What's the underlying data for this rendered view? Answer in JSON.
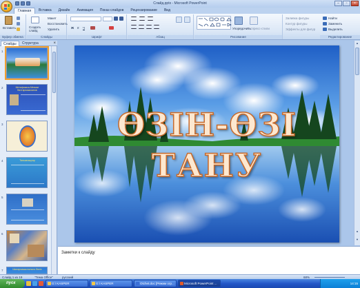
{
  "window": {
    "title": "Слайд.pptx - Microsoft PowerPoint"
  },
  "ribbon": {
    "tabs": [
      "Главная",
      "Вставка",
      "Дизайн",
      "Анимация",
      "Показ слайдов",
      "Рецензирование",
      "Вид"
    ],
    "active_tab": "Главная",
    "groups": {
      "clipboard": {
        "label": "Буфер обмена",
        "paste": "Вставить"
      },
      "slides": {
        "label": "Слайды",
        "create": "Создать слайд",
        "layout": "Макет",
        "reset": "Восстановить",
        "delete": "Удалить"
      },
      "font": {
        "label": "Шрифт"
      },
      "paragraph": {
        "label": "Абзац"
      },
      "drawing": {
        "label": "Рисование",
        "arrange": "Упорядочить",
        "quick_styles": "Экспресс-стили",
        "fill": "Заливка фигуры",
        "outline": "Контур фигуры",
        "effects": "Эффекты для фигур"
      },
      "editing": {
        "label": "Редактирование",
        "find": "Найти",
        "replace": "Заменить",
        "select": "Выделить"
      }
    }
  },
  "left_pane": {
    "tabs": [
      "Слайды",
      "Структура"
    ],
    "close": "×",
    "thumbnails": [
      {
        "num": "1"
      },
      {
        "num": "2",
        "title": "Метафизика-Мехмат Ваттархажиханов"
      },
      {
        "num": "3"
      },
      {
        "num": "4",
        "title": "Танымсыңсар"
      },
      {
        "num": "5"
      },
      {
        "num": "6"
      },
      {
        "num": "7",
        "title": "Шығармашылығына бөліс"
      }
    ]
  },
  "slide": {
    "title_line1": "ӨЗІН-ӨЗІ",
    "title_line2": "ТАНУ"
  },
  "notes": {
    "placeholder": "Заметки к слайду"
  },
  "status": {
    "slide_info": "Слайд 1 из 19",
    "theme": "\"Тема Office\"",
    "language": "русский",
    "zoom": "68%"
  },
  "taskbar": {
    "start": "пуск",
    "tasks": [
      "G:\\ KASPER",
      "G:\\ KASPER",
      "Otchet.doc [Режим огр...",
      "Microsoft PowerPoint ..."
    ],
    "clock": "14:15"
  }
}
